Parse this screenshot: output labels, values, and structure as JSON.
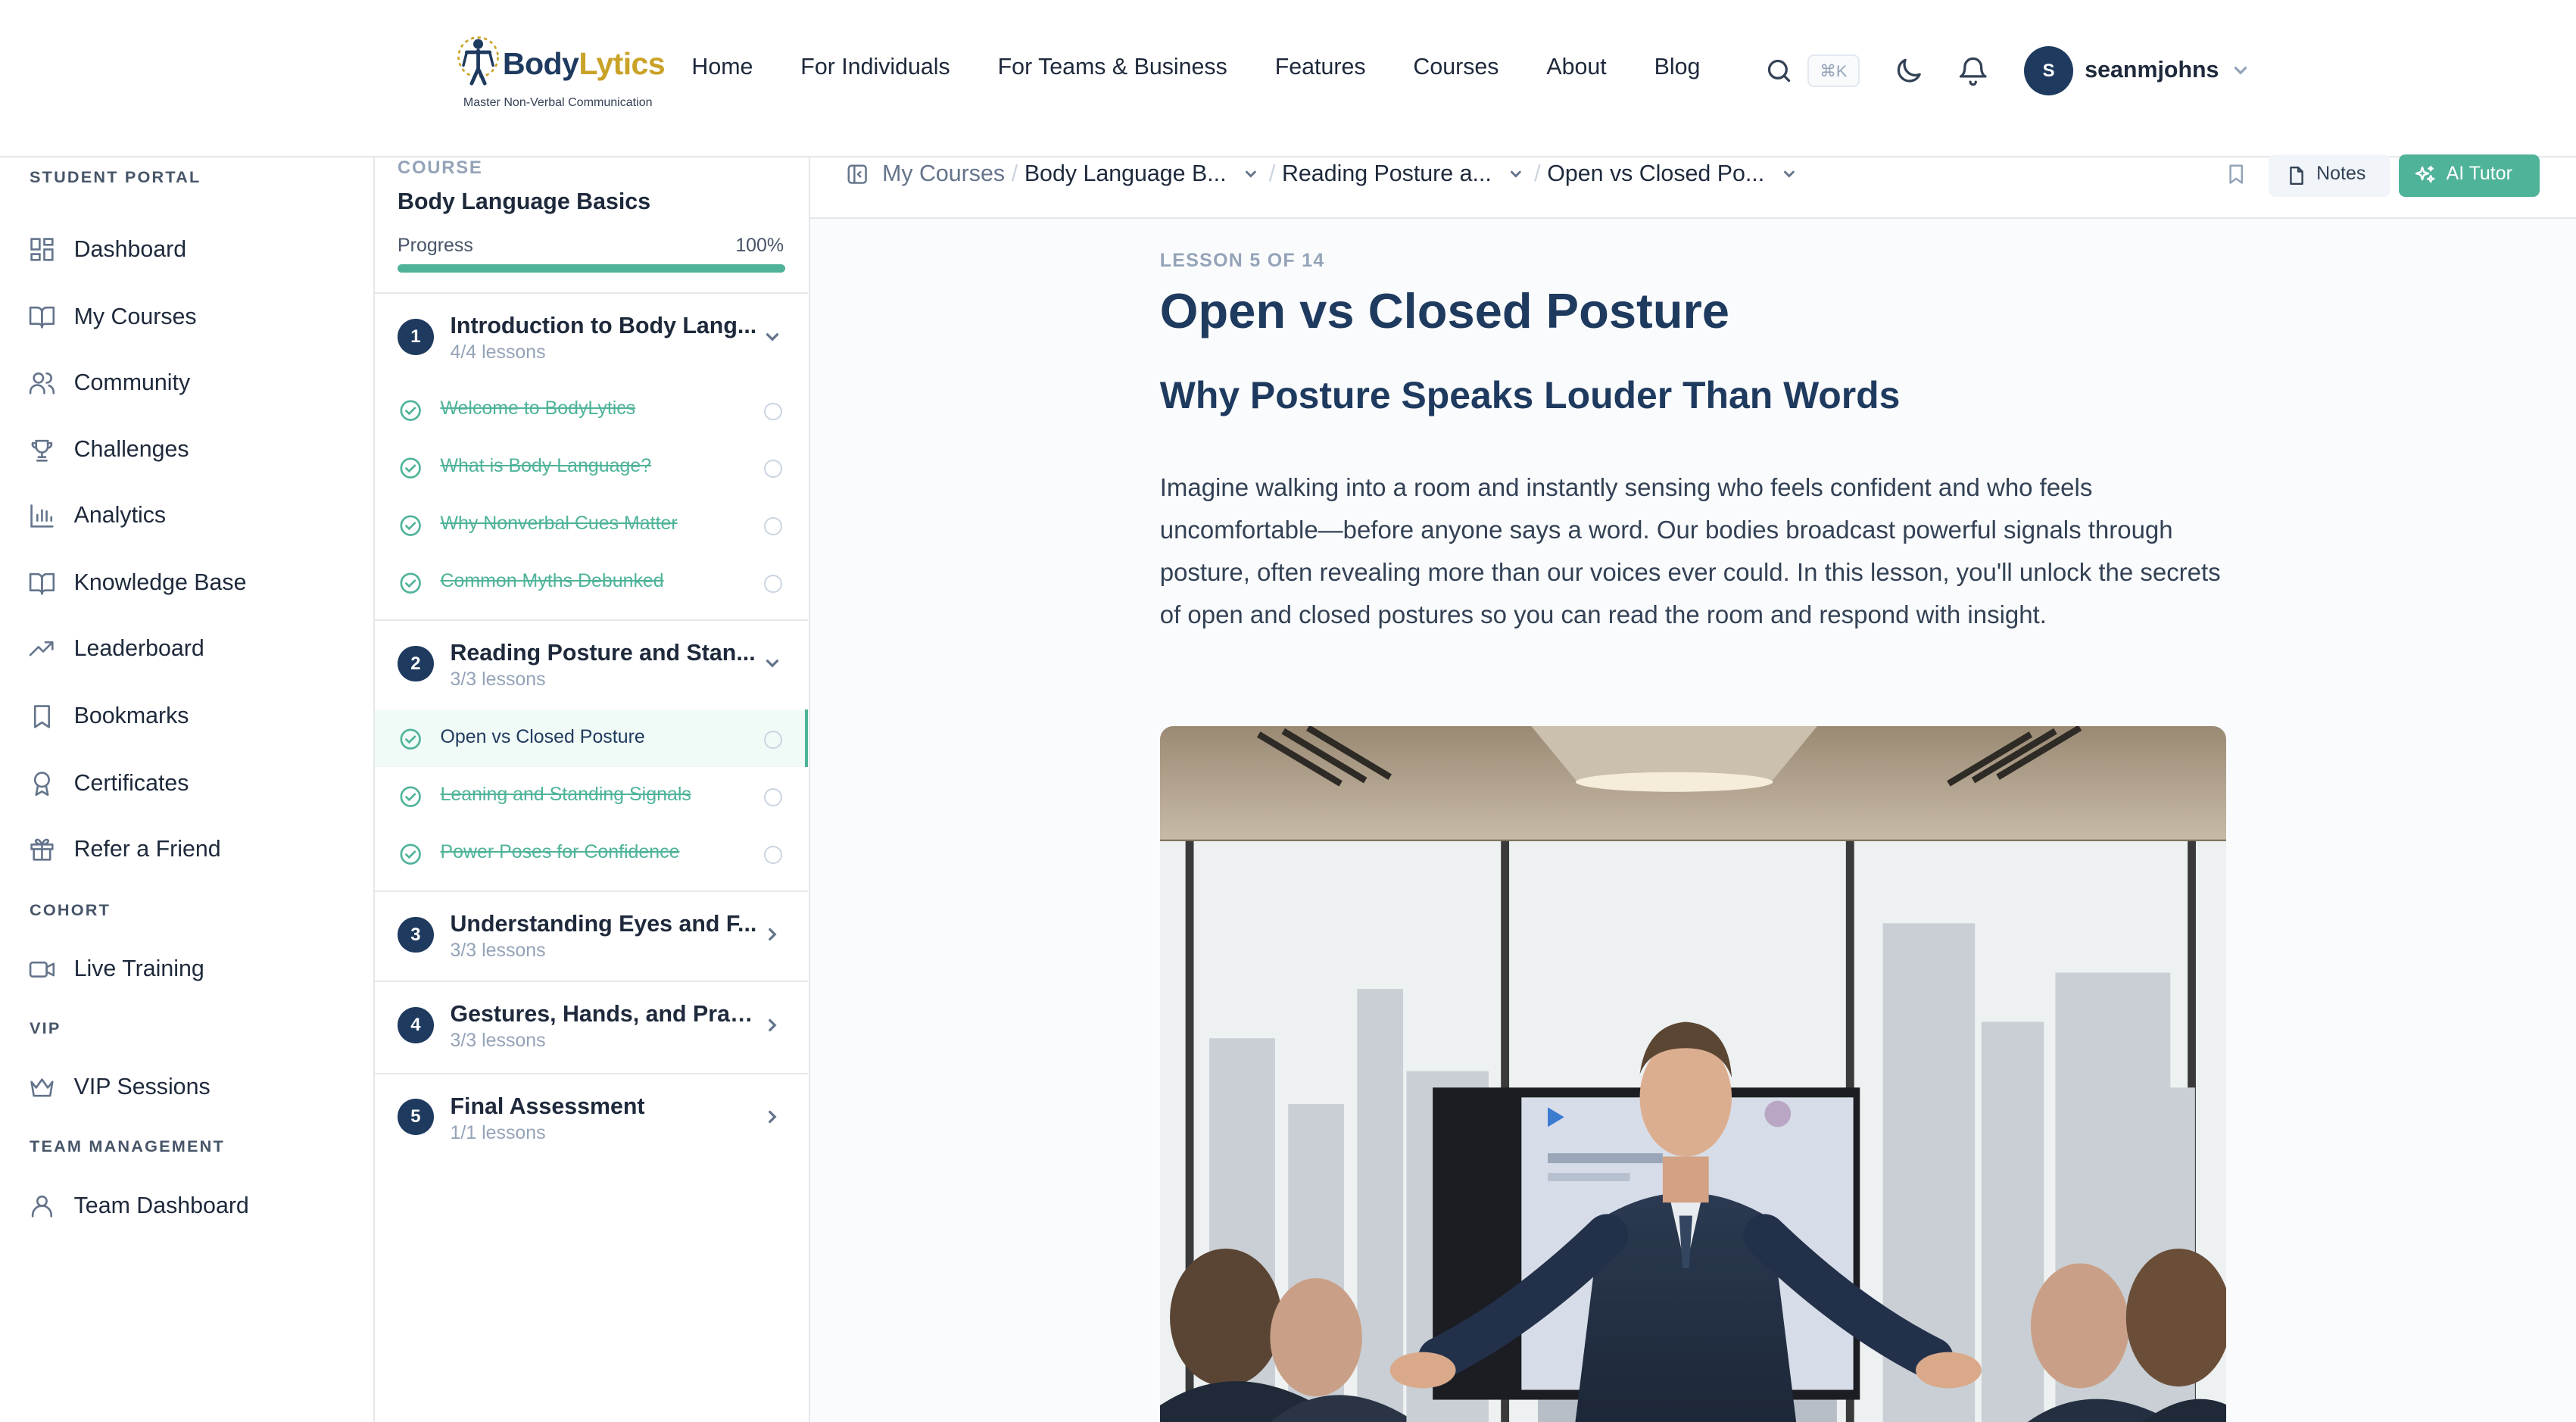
{
  "brand": {
    "name_part1": "Body",
    "name_part2": "Lytics",
    "tagline": "Master Non-Verbal Communication"
  },
  "nav": {
    "links": [
      "Home",
      "For Individuals",
      "For Teams & Business",
      "Features",
      "Courses",
      "About",
      "Blog"
    ],
    "search_shortcut": "⌘K",
    "user_initial": "S",
    "username": "seanmjohns"
  },
  "sidebar": {
    "sections": [
      {
        "title": "STUDENT PORTAL",
        "items": [
          {
            "label": "Dashboard",
            "icon": "grid-icon"
          },
          {
            "label": "My Courses",
            "icon": "book-open-icon"
          },
          {
            "label": "Community",
            "icon": "users-icon"
          },
          {
            "label": "Challenges",
            "icon": "trophy-icon"
          },
          {
            "label": "Analytics",
            "icon": "bar-chart-icon"
          },
          {
            "label": "Knowledge Base",
            "icon": "book-open-icon"
          },
          {
            "label": "Leaderboard",
            "icon": "trending-up-icon"
          },
          {
            "label": "Bookmarks",
            "icon": "bookmark-icon"
          },
          {
            "label": "Certificates",
            "icon": "award-icon"
          },
          {
            "label": "Refer a Friend",
            "icon": "gift-icon"
          }
        ]
      },
      {
        "title": "COHORT",
        "items": [
          {
            "label": "Live Training",
            "icon": "video-icon"
          }
        ]
      },
      {
        "title": "VIP",
        "items": [
          {
            "label": "VIP Sessions",
            "icon": "crown-icon"
          }
        ]
      },
      {
        "title": "TEAM MANAGEMENT",
        "items": [
          {
            "label": "Team Dashboard",
            "icon": "user-icon"
          }
        ]
      }
    ]
  },
  "outline": {
    "label": "COURSE",
    "course": "Body Language Basics",
    "progress_label": "Progress",
    "progress_text": "100%",
    "progress": 1.0,
    "modules": [
      {
        "num": "1",
        "title": "Introduction to Body Lang...",
        "sub": "4/4 lessons",
        "expanded": true,
        "lessons": [
          "Welcome to BodyLytics",
          "What is Body Language?",
          "Why Nonverbal Cues Matter",
          "Common Myths Debunked"
        ]
      },
      {
        "num": "2",
        "title": "Reading Posture and Stan...",
        "sub": "3/3 lessons",
        "expanded": true,
        "lessons": [
          "Open vs Closed Posture",
          "Leaning and Standing Signals",
          "Power Poses for Confidence"
        ]
      },
      {
        "num": "3",
        "title": "Understanding Eyes and F...",
        "sub": "3/3 lessons",
        "expanded": false,
        "lessons": []
      },
      {
        "num": "4",
        "title": "Gestures, Hands, and Pract...",
        "sub": "3/3 lessons",
        "expanded": false,
        "lessons": []
      },
      {
        "num": "5",
        "title": "Final Assessment",
        "sub": "1/1 lessons",
        "expanded": false,
        "lessons": []
      }
    ]
  },
  "breadcrumb": {
    "root": "My Courses",
    "course": "Body Language B...",
    "module": "Reading Posture a...",
    "lesson": "Open vs Closed Po..."
  },
  "actions": {
    "notes": "Notes",
    "tutor": "AI Tutor"
  },
  "content": {
    "lesson_num": "LESSON 5 OF 14",
    "title": "Open vs Closed Posture",
    "subtitle": "Why Posture Speaks Louder Than Words",
    "paragraph": "Imagine walking into a room and instantly sensing who feels confident and who feels uncomfortable—before anyone says a word. Our bodies broadcast powerful signals through posture, often revealing more than our voices ever could. In this lesson, you'll unlock the secrets of open and closed postures so you can read the room and respond with insight."
  },
  "colors": {
    "accent": "#4fb39a",
    "navy": "#1e3a5f",
    "gold": "#c9a227"
  }
}
